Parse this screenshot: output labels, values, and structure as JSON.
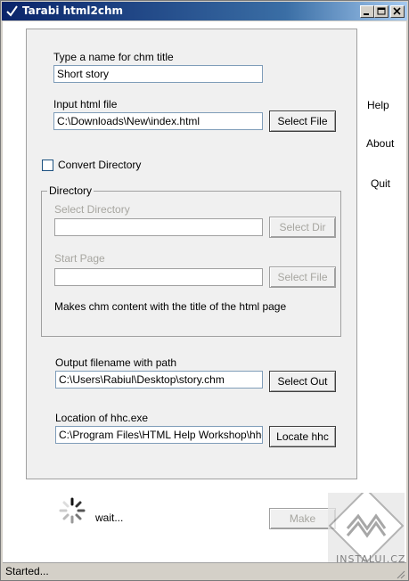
{
  "window": {
    "title": "Tarabi html2chm",
    "app_icon": "checkmark-app-icon",
    "controls": [
      "minimize-icon",
      "maximize-icon",
      "close-icon"
    ]
  },
  "form": {
    "chm_title_label": "Type a name for chm title",
    "chm_title_value": "Short story",
    "input_file_label": "Input html file",
    "input_file_value": "C:\\Downloads\\New\\index.html",
    "select_file_button": "Select File",
    "convert_directory_label": "Convert Directory",
    "convert_directory_checked": false,
    "directory": {
      "legend": "Directory",
      "select_dir_label": "Select Directory",
      "select_dir_value": "",
      "select_dir_button": "Select Dir",
      "start_page_label": "Start Page",
      "start_page_value": "",
      "start_page_button": "Select File",
      "note": "Makes chm content with the title of the html page"
    },
    "output_label": "Output filename with path",
    "output_value": "C:\\Users\\Rabiul\\Desktop\\story.chm",
    "select_out_button": "Select Out",
    "hhc_label": "Location of hhc.exe",
    "hhc_value": "C:\\Program Files\\HTML Help Workshop\\hhc.exe",
    "locate_hhc_button": "Locate hhc"
  },
  "side_menu": {
    "help": "Help",
    "about": "About",
    "quit": "Quit"
  },
  "progress": {
    "wait_text": "wait...",
    "make_button": "Make"
  },
  "status_bar": {
    "text": "Started..."
  },
  "watermark": {
    "text": "INSTALUJ.CZ"
  },
  "colors": {
    "title_gradient_start": "#0a246a",
    "title_gradient_end": "#a6caf0",
    "disabled_text": "#a7a6a0"
  }
}
